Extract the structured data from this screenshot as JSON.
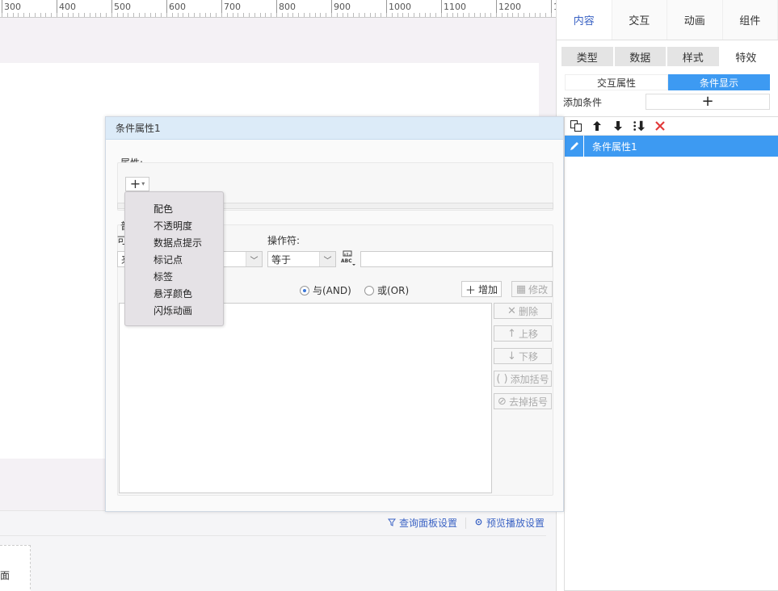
{
  "ruler": {
    "ticks": [
      "300",
      "400",
      "500",
      "600",
      "700",
      "800",
      "900",
      "1000",
      "1100",
      "1200",
      "1"
    ]
  },
  "right_panel": {
    "main_tabs": [
      {
        "label": "内容"
      },
      {
        "label": "交互"
      },
      {
        "label": "动画"
      },
      {
        "label": "组件"
      }
    ],
    "sub_tabs": [
      {
        "label": "类型"
      },
      {
        "label": "数据"
      },
      {
        "label": "样式"
      },
      {
        "label": "特效"
      }
    ],
    "segment": {
      "left": "交互属性",
      "right": "条件显示"
    },
    "add_condition": {
      "label": "添加条件",
      "button": "+"
    },
    "conditions": [
      {
        "label": "条件属性1"
      }
    ]
  },
  "dialog": {
    "title": "条件属性1",
    "attr_label": "属性:",
    "plus": "+",
    "partial_label_1": "普",
    "partial_label_2": "可",
    "operator_label": "操作符:",
    "field_select_value": "来",
    "operator_value": "等于",
    "abc_label": "ABC",
    "radio_and": "与(AND)",
    "radio_or": "或(OR)",
    "add_btn": "增加",
    "modify_btn": "修改",
    "delete_btn": "删除",
    "up_btn": "上移",
    "down_btn": "下移",
    "add_paren_btn": "添加括号",
    "remove_paren_btn": "去掉括号"
  },
  "menu": {
    "items": [
      {
        "label": "配色"
      },
      {
        "label": "不透明度"
      },
      {
        "label": "数据点提示"
      },
      {
        "label": "标记点"
      },
      {
        "label": "标签"
      },
      {
        "label": "悬浮颜色"
      },
      {
        "label": "闪烁动画"
      }
    ]
  },
  "bottom": {
    "query_panel": "查询面板设置",
    "preview": "预览播放设置",
    "edge_text": "面"
  },
  "colors": {
    "accent": "#3d9af2",
    "link": "#3b63c4",
    "delete": "#e23b3b"
  }
}
